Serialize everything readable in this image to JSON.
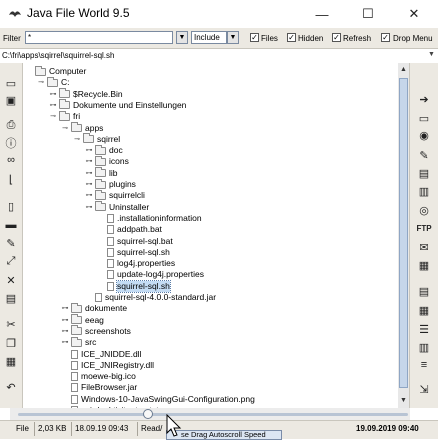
{
  "window": {
    "title": "Java File World 9.5",
    "minimize": "—",
    "maximize": "☐",
    "close": "✕"
  },
  "filter_bar": {
    "filter_label": "Filter",
    "filter_value": "*",
    "mode_value": "Include",
    "checkboxes": [
      {
        "label": "Files",
        "checked": true
      },
      {
        "label": "Hidden",
        "checked": true
      },
      {
        "label": "Refresh",
        "checked": true
      },
      {
        "label": "Drop Menu",
        "checked": true
      }
    ]
  },
  "path": "C:\\fri\\apps\\sqirrel\\squirrel-sql.sh",
  "tree": [
    {
      "label": "Computer",
      "type": "folder",
      "toggle": "",
      "depth": 0
    },
    {
      "label": "C:",
      "type": "folder",
      "toggle": "○",
      "depth": 1
    },
    {
      "label": "$Recycle.Bin",
      "type": "folder",
      "toggle": "•",
      "depth": 2
    },
    {
      "label": "Dokumente und Einstellungen",
      "type": "folder",
      "toggle": "•",
      "depth": 2
    },
    {
      "label": "fri",
      "type": "folder",
      "toggle": "○",
      "depth": 2
    },
    {
      "label": "apps",
      "type": "folder",
      "toggle": "○",
      "depth": 3
    },
    {
      "label": "sqirrel",
      "type": "folder",
      "toggle": "○",
      "depth": 4
    },
    {
      "label": "doc",
      "type": "folder",
      "toggle": "•",
      "depth": 5
    },
    {
      "label": "icons",
      "type": "folder",
      "toggle": "•",
      "depth": 5
    },
    {
      "label": "lib",
      "type": "folder",
      "toggle": "•",
      "depth": 5
    },
    {
      "label": "plugins",
      "type": "folder",
      "toggle": "•",
      "depth": 5
    },
    {
      "label": "squirrelcli",
      "type": "folder",
      "toggle": "•",
      "depth": 5
    },
    {
      "label": "Uninstaller",
      "type": "folder",
      "toggle": "•",
      "depth": 5
    },
    {
      "label": ".installationinformation",
      "type": "file",
      "toggle": "",
      "depth": 6
    },
    {
      "label": "addpath.bat",
      "type": "file",
      "toggle": "",
      "depth": 6
    },
    {
      "label": "squirrel-sql.bat",
      "type": "file",
      "toggle": "",
      "depth": 6
    },
    {
      "label": "squirrel-sql.sh",
      "type": "file",
      "toggle": "",
      "depth": 6
    },
    {
      "label": "log4j.properties",
      "type": "file",
      "toggle": "",
      "depth": 6
    },
    {
      "label": "update-log4j.properties",
      "type": "file",
      "toggle": "",
      "depth": 6
    },
    {
      "label": "squirrel-sql.sh",
      "type": "file",
      "toggle": "",
      "depth": 6,
      "selected": true
    },
    {
      "label": "squirrel-sql-4.0.0-standard.jar",
      "type": "file",
      "toggle": "",
      "depth": 5
    },
    {
      "label": "dokumente",
      "type": "folder",
      "toggle": "•",
      "depth": 3
    },
    {
      "label": "eeag",
      "type": "folder",
      "toggle": "•",
      "depth": 3
    },
    {
      "label": "screenshots",
      "type": "folder",
      "toggle": "•",
      "depth": 3
    },
    {
      "label": "src",
      "type": "folder",
      "toggle": "•",
      "depth": 3
    },
    {
      "label": "ICE_JNIDDE.dll",
      "type": "file",
      "toggle": "",
      "depth": 3
    },
    {
      "label": "ICE_JNIRegistry.dll",
      "type": "file",
      "toggle": "",
      "depth": 3
    },
    {
      "label": "moewe-big.ico",
      "type": "file",
      "toggle": "",
      "depth": 3
    },
    {
      "label": "FileBrowser.jar",
      "type": "file",
      "toggle": "",
      "depth": 3
    },
    {
      "label": "Windows-10-JavaSwingGui-Configuration.png",
      "type": "file",
      "toggle": "",
      "depth": 3
    },
    {
      "label": "sqirrl_aktivitaeten.txt",
      "type": "file",
      "toggle": "",
      "depth": 3
    }
  ],
  "left_toolbar_icons": [
    "page-icon",
    "save-icon",
    "print-icon",
    "info-icon",
    "binoculars-icon",
    "hook-icon",
    "blank-doc-icon",
    "folder-icon",
    "edit-icon",
    "expand-icon",
    "delete-icon",
    "clipboard-icon",
    "scissors-icon",
    "copy-icon",
    "paste-icon",
    "duplicate-icon",
    "undo-icon"
  ],
  "right_toolbar_icons": [
    "arrow-right-icon",
    "monitor-icon",
    "eye-icon",
    "notes-icon",
    "open-file-icon",
    "pdf-icon",
    "compress-icon",
    "rename-icon",
    "ftp-icon",
    "mail-icon",
    "calculator-icon",
    "properties-icon",
    "grid-icon",
    "list-icon",
    "details-icon",
    "text-icon",
    "export-icon"
  ],
  "ftp_label": "FTP",
  "status": {
    "kind": "File",
    "size": "2,03 KB",
    "date": "18.09.19 09:43",
    "attr": "Read/",
    "tooltip": "se Drag Autoscroll Speed",
    "clock": "19.09.2019 09:40"
  },
  "colors": {
    "selection": "#c4dcf4",
    "scroll_thumb": "#c6d6ea",
    "toolbar_bg": "#ece9e2"
  }
}
